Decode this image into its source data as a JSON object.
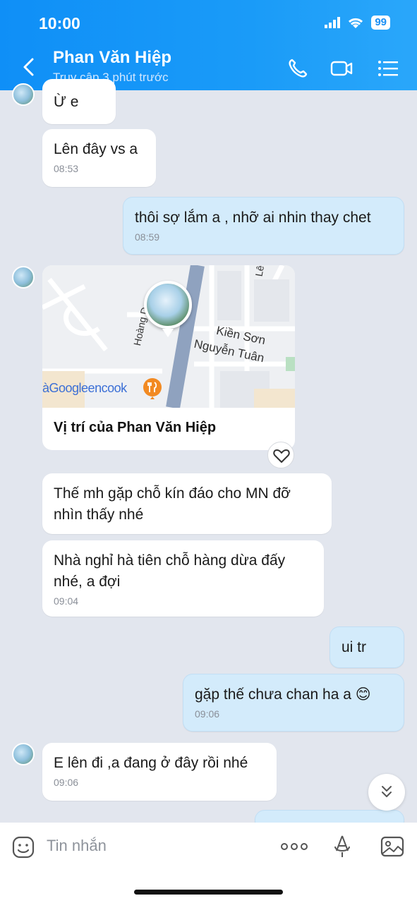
{
  "status": {
    "time": "10:00",
    "battery": "99"
  },
  "header": {
    "name": "Phan Văn Hiệp",
    "last_seen": "Truy cập 3 phút trước"
  },
  "messages": [
    {
      "text": "Ừ e"
    },
    {
      "text": "Lên đây vs a",
      "time": "08:53"
    },
    {
      "text": "thôi sợ lắm a , nhỡ ai nhin thay chet",
      "time": "08:59"
    },
    {
      "text": "Thế mh gặp chỗ kín đáo cho MN đỡ nhìn thấy nhé"
    },
    {
      "text": "Nhà nghỉ hà tiên chỗ hàng dừa đấy nhé, a đợi",
      "time": "09:04"
    },
    {
      "text": "ui tr"
    },
    {
      "text": "gặp thế chưa chan ha a 😊",
      "time": "09:06"
    },
    {
      "text": "E lên đi ,a đang ở đây rồi nhé",
      "time": "09:06"
    }
  ],
  "location": {
    "label": "Vị trí của Phan Văn Hiệp",
    "map_text": {
      "street1": "Kiền Sơn",
      "street2": "Nguyễn Tuân",
      "street3": "Hoàng D",
      "poi": "àGoogleencook",
      "corner": "Lê"
    }
  },
  "composer": {
    "placeholder": "Tin nhắn"
  }
}
